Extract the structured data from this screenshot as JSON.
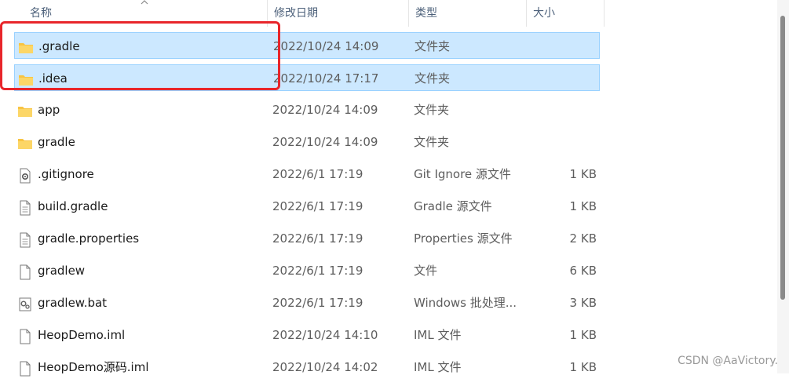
{
  "columns": {
    "name": "名称",
    "date": "修改日期",
    "type": "类型",
    "size": "大小"
  },
  "files": [
    {
      "name": ".gradle",
      "date": "2022/10/24 14:09",
      "type": "文件夹",
      "size": "",
      "icon": "folder-icon",
      "selected": true
    },
    {
      "name": ".idea",
      "date": "2022/10/24 17:17",
      "type": "文件夹",
      "size": "",
      "icon": "folder-icon",
      "selected": true
    },
    {
      "name": "app",
      "date": "2022/10/24 14:09",
      "type": "文件夹",
      "size": "",
      "icon": "folder-icon",
      "selected": false
    },
    {
      "name": "gradle",
      "date": "2022/10/24 14:09",
      "type": "文件夹",
      "size": "",
      "icon": "folder-icon",
      "selected": false
    },
    {
      "name": ".gitignore",
      "date": "2022/6/1 17:19",
      "type": "Git Ignore 源文件",
      "size": "1 KB",
      "icon": "settings-file-icon",
      "selected": false
    },
    {
      "name": "build.gradle",
      "date": "2022/6/1 17:19",
      "type": "Gradle 源文件",
      "size": "1 KB",
      "icon": "text-file-icon",
      "selected": false
    },
    {
      "name": "gradle.properties",
      "date": "2022/6/1 17:19",
      "type": "Properties 源文件",
      "size": "2 KB",
      "icon": "text-file-icon",
      "selected": false
    },
    {
      "name": "gradlew",
      "date": "2022/6/1 17:19",
      "type": "文件",
      "size": "6 KB",
      "icon": "blank-file-icon",
      "selected": false
    },
    {
      "name": "gradlew.bat",
      "date": "2022/6/1 17:19",
      "type": "Windows 批处理...",
      "size": "3 KB",
      "icon": "batch-file-icon",
      "selected": false
    },
    {
      "name": "HeopDemo.iml",
      "date": "2022/10/24 14:10",
      "type": "IML 文件",
      "size": "1 KB",
      "icon": "blank-file-icon",
      "selected": false
    },
    {
      "name": "HeopDemo源码.iml",
      "date": "2022/10/24 14:02",
      "type": "IML 文件",
      "size": "1 KB",
      "icon": "blank-file-icon",
      "selected": false
    }
  ],
  "watermark": "CSDN @AaVictory.",
  "colors": {
    "selection_bg": "#cce8ff",
    "selection_border": "#99d1ff",
    "highlight_border": "#e8262b",
    "folder": "#f8c443"
  }
}
